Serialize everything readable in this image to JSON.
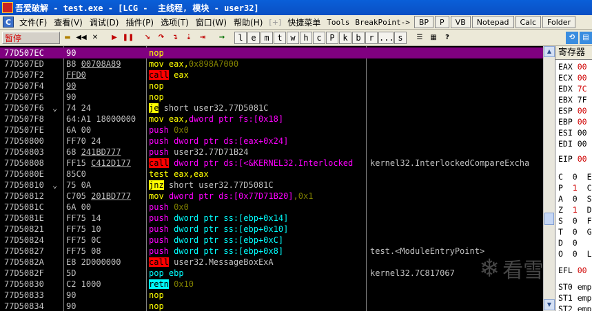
{
  "window": {
    "title": "吾爱破解 - test.exe - [LCG -  主线程, 模块 - user32]",
    "logo_text": "吾爱破解"
  },
  "menu": {
    "items": [
      "文件(F)",
      "查看(V)",
      "调试(D)",
      "插件(P)",
      "选项(T)",
      "窗口(W)",
      "帮助(H)"
    ],
    "plus": "[+]",
    "extra": [
      "快捷菜单",
      "Tools",
      "BreakPoint->"
    ],
    "buttons": [
      "BP",
      "P",
      "VB",
      "Notepad",
      "Calc",
      "Folder"
    ]
  },
  "toolbar": {
    "status": "暂停",
    "letter_buttons": [
      "l",
      "e",
      "m",
      "t",
      "w",
      "h",
      "c",
      "P",
      "k",
      "b",
      "r",
      "...",
      "s"
    ]
  },
  "disasm": [
    {
      "addr": "77D507EC",
      "jmp": "",
      "hex": "90",
      "asm": [
        {
          "t": "nop",
          "c": "t-nop"
        }
      ],
      "cmt": "",
      "sel": true
    },
    {
      "addr": "77D507ED",
      "jmp": "",
      "hex": "B8 00708A89",
      "hex_u": "00708A89",
      "asm": [
        {
          "t": "mov",
          "c": "t-mov"
        },
        {
          "t": " eax,",
          "c": "t-mov"
        },
        {
          "t": "0x898A7000",
          "c": "t-num"
        }
      ],
      "cmt": ""
    },
    {
      "addr": "77D507F2",
      "jmp": "",
      "hex": "FFD0",
      "hex_u_all": true,
      "asm": [
        {
          "t": "call",
          "c": "t-call"
        },
        {
          "t": " eax",
          "c": "t-mov"
        }
      ],
      "cmt": ""
    },
    {
      "addr": "77D507F4",
      "jmp": "",
      "hex": "90",
      "hex_u_all": true,
      "asm": [
        {
          "t": "nop",
          "c": "t-nop"
        }
      ],
      "cmt": ""
    },
    {
      "addr": "77D507F5",
      "jmp": "",
      "hex": "90",
      "asm": [
        {
          "t": "nop",
          "c": "t-nop"
        }
      ],
      "cmt": ""
    },
    {
      "addr": "77D507F6",
      "jmp": "⌄",
      "hex": "74 24",
      "asm": [
        {
          "t": "je",
          "c": "t-jcc"
        },
        {
          "t": " short user32.77D5081C",
          "c": "t-plain"
        }
      ],
      "cmt": ""
    },
    {
      "addr": "77D507F8",
      "jmp": "",
      "hex": "64:A1 18000000",
      "asm": [
        {
          "t": "mov",
          "c": "t-mov"
        },
        {
          "t": " eax,",
          "c": "t-mov"
        },
        {
          "t": "dword ptr fs:[0x18]",
          "c": "t-mag"
        }
      ],
      "cmt": ""
    },
    {
      "addr": "77D507FE",
      "jmp": "",
      "hex": "6A 00",
      "asm": [
        {
          "t": "push",
          "c": "t-push"
        },
        {
          "t": " 0x0",
          "c": "t-num"
        }
      ],
      "cmt": ""
    },
    {
      "addr": "77D50800",
      "jmp": "",
      "hex": "FF70 24",
      "asm": [
        {
          "t": "push",
          "c": "t-push"
        },
        {
          "t": " dword ptr ds:[eax+0x24]",
          "c": "t-mag"
        }
      ],
      "cmt": ""
    },
    {
      "addr": "77D50803",
      "jmp": "",
      "hex": "68 241BD777",
      "hex_u": "241BD777",
      "asm": [
        {
          "t": "push",
          "c": "t-push"
        },
        {
          "t": " user32.77D71B24",
          "c": "t-plain"
        }
      ],
      "cmt": ""
    },
    {
      "addr": "77D50808",
      "jmp": "",
      "hex": "FF15 C412D177",
      "hex_u": "C412D177",
      "asm": [
        {
          "t": "call",
          "c": "t-call"
        },
        {
          "t": " dword ptr ds:[<&KERNEL32.Interlocked",
          "c": "t-mag"
        }
      ],
      "cmt": "kernel32.InterlockedCompareExcha"
    },
    {
      "addr": "77D5080E",
      "jmp": "",
      "hex": "85C0",
      "asm": [
        {
          "t": "test",
          "c": "t-test"
        },
        {
          "t": " eax,eax",
          "c": "t-test"
        }
      ],
      "cmt": ""
    },
    {
      "addr": "77D50810",
      "jmp": "⌄",
      "hex": "75 0A",
      "asm": [
        {
          "t": "jnz",
          "c": "t-jcc"
        },
        {
          "t": " short user32.77D5081C",
          "c": "t-plain"
        }
      ],
      "cmt": ""
    },
    {
      "addr": "77D50812",
      "jmp": "",
      "hex": "C705 201BD777",
      "hex_u": "201BD777",
      "asm": [
        {
          "t": "mov",
          "c": "t-mov"
        },
        {
          "t": " dword ptr ds:[0x77D71B20]",
          "c": "t-mag"
        },
        {
          "t": ",0x1",
          "c": "t-num"
        }
      ],
      "cmt": ""
    },
    {
      "addr": "77D5081C",
      "jmp": "",
      "hex": "6A 00",
      "asm": [
        {
          "t": "push",
          "c": "t-push"
        },
        {
          "t": " 0x0",
          "c": "t-num"
        }
      ],
      "cmt": ""
    },
    {
      "addr": "77D5081E",
      "jmp": "",
      "hex": "FF75 14",
      "asm": [
        {
          "t": "push",
          "c": "t-push"
        },
        {
          "t": " dword ptr ss:[ebp+0x14]",
          "c": "t-cyan"
        }
      ],
      "cmt": ""
    },
    {
      "addr": "77D50821",
      "jmp": "",
      "hex": "FF75 10",
      "asm": [
        {
          "t": "push",
          "c": "t-push"
        },
        {
          "t": " dword ptr ss:[ebp+0x10]",
          "c": "t-cyan"
        }
      ],
      "cmt": ""
    },
    {
      "addr": "77D50824",
      "jmp": "",
      "hex": "FF75 0C",
      "asm": [
        {
          "t": "push",
          "c": "t-push"
        },
        {
          "t": " dword ptr ss:[ebp+0xC]",
          "c": "t-cyan"
        }
      ],
      "cmt": ""
    },
    {
      "addr": "77D50827",
      "jmp": "",
      "hex": "FF75 08",
      "asm": [
        {
          "t": "push",
          "c": "t-push"
        },
        {
          "t": " dword ptr ss:[ebp+0x8]",
          "c": "t-cyan"
        }
      ],
      "cmt": "test.<ModuleEntryPoint>"
    },
    {
      "addr": "77D5082A",
      "jmp": "",
      "hex": "E8 2D000000",
      "asm": [
        {
          "t": "call",
          "c": "t-call"
        },
        {
          "t": " user32.MessageBoxExA",
          "c": "t-plain"
        }
      ],
      "cmt": ""
    },
    {
      "addr": "77D5082F",
      "jmp": "",
      "hex": "5D",
      "asm": [
        {
          "t": "pop",
          "c": "t-pop"
        },
        {
          "t": " ebp",
          "c": "t-cyan"
        }
      ],
      "cmt": "kernel32.7C817067"
    },
    {
      "addr": "77D50830",
      "jmp": "",
      "hex": "C2 1000",
      "asm": [
        {
          "t": "retn",
          "c": "t-retn"
        },
        {
          "t": " 0x10",
          "c": "t-num"
        }
      ],
      "cmt": ""
    },
    {
      "addr": "77D50833",
      "jmp": "",
      "hex": "90",
      "asm": [
        {
          "t": "nop",
          "c": "t-nop"
        }
      ],
      "cmt": ""
    },
    {
      "addr": "77D50834",
      "jmp": "",
      "hex": "90",
      "asm": [
        {
          "t": "nop",
          "c": "t-nop"
        }
      ],
      "cmt": ""
    }
  ],
  "registers": {
    "header": "寄存器",
    "gp": [
      {
        "n": "EAX",
        "v": "00"
      },
      {
        "n": "ECX",
        "v": "00"
      },
      {
        "n": "EDX",
        "v": "7C"
      },
      {
        "n": "EBX",
        "v": "7F",
        "black": true
      },
      {
        "n": "ESP",
        "v": "00"
      },
      {
        "n": "EBP",
        "v": "00"
      },
      {
        "n": "ESI",
        "v": "00",
        "black": true
      },
      {
        "n": "EDI",
        "v": "00",
        "black": true
      }
    ],
    "eip": {
      "n": "EIP",
      "v": "00"
    },
    "flags": [
      {
        "n": "C",
        "b": "0",
        "s": "ES"
      },
      {
        "n": "P",
        "b": "1",
        "s": "CS",
        "red": true
      },
      {
        "n": "A",
        "b": "0",
        "s": "SS"
      },
      {
        "n": "Z",
        "b": "1",
        "s": "DS",
        "red": true
      },
      {
        "n": "S",
        "b": "0",
        "s": "FS"
      },
      {
        "n": "T",
        "b": "0",
        "s": "GS"
      },
      {
        "n": "D",
        "b": "0",
        "s": ""
      },
      {
        "n": "O",
        "b": "0",
        "s": "La"
      }
    ],
    "efl": {
      "n": "EFL",
      "v": "00"
    },
    "st": [
      {
        "n": "ST0",
        "v": "emp"
      },
      {
        "n": "ST1",
        "v": "emp"
      },
      {
        "n": "ST2",
        "v": "emp"
      }
    ]
  },
  "watermark": {
    "flake": "❄",
    "text": "看雪"
  }
}
